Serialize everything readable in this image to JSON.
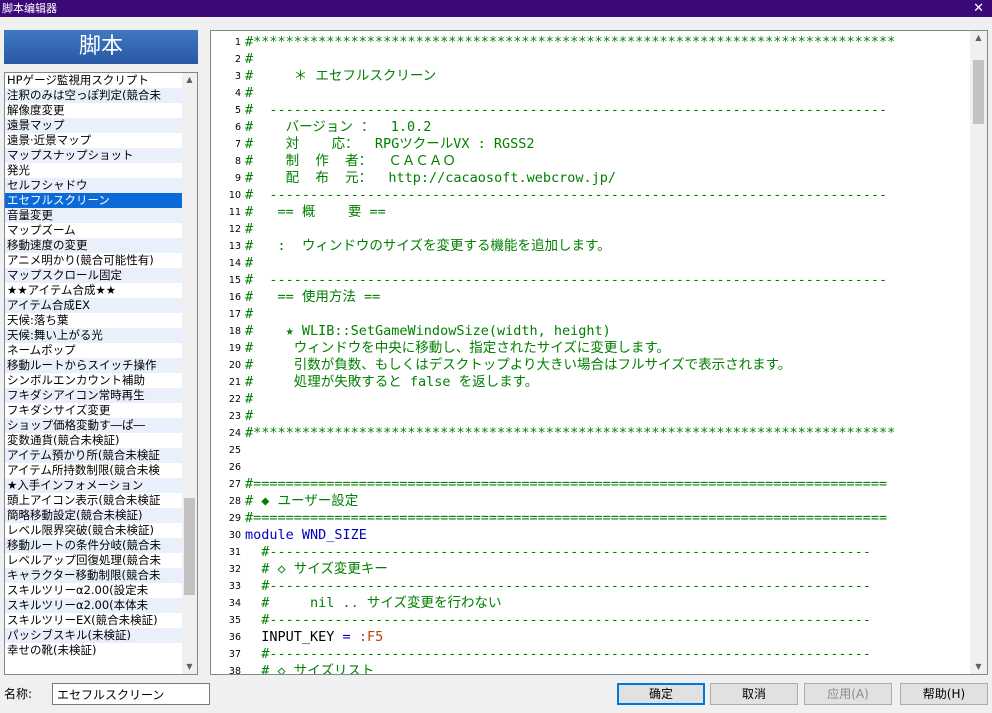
{
  "window": {
    "title": "脚本编辑器",
    "close_glyph": "✕"
  },
  "left_header": "脚本",
  "script_list": [
    "HPゲージ監視用スクリプト",
    "注釈のみは空っぽ判定(競合未",
    "解像度変更",
    "遠景マップ",
    "遠景·近景マップ",
    "マップスナップショット",
    "発光",
    "セルフシャドウ",
    "エセフルスクリーン",
    "音量変更",
    "マップズーム",
    "移動速度の変更",
    "アニメ明かり(競合可能性有)",
    "マップスクロール固定",
    "★★アイテム合成★★",
    "アイテム合成EX",
    "天候:落ち葉",
    "天候:舞い上がる光",
    "ネームポップ",
    "移動ルートからスイッチ操作",
    "シンボルエンカウント補助",
    "フキダシアイコン常時再生",
    "フキダシサイズ変更",
    "ショップ価格変動す―ぱ―",
    "変数通貨(競合未検証)",
    "アイテム預かり所(競合未検証",
    "アイテム所持数制限(競合未検",
    "★入手インフォメーション",
    "頭上アイコン表示(競合未検証",
    "簡略移動設定(競合未検証)",
    "レベル限界突破(競合未検証)",
    "移動ルートの条件分岐(競合未",
    "レベルアップ回復処理(競合未",
    "キャラクター移動制限(競合未",
    "スキルツリーα2.00(設定未",
    "スキルツリーα2.00(本体未",
    "スキルツリーEX(競合未検証)",
    "パッシブスキル(未検証)",
    "幸せの靴(未検証)"
  ],
  "selected_index": 8,
  "code_lines": [
    {
      "n": "1",
      "t": "#*******************************************************************************",
      "c": "c"
    },
    {
      "n": "2",
      "t": "#",
      "c": "c"
    },
    {
      "n": "3",
      "t": "#     ＊ エセフルスクリーン",
      "c": "c"
    },
    {
      "n": "4",
      "t": "#",
      "c": "c"
    },
    {
      "n": "5",
      "t": "#  ----------------------------------------------------------------------------",
      "c": "c"
    },
    {
      "n": "6",
      "t": "#    バージョン ：  1.0.2",
      "c": "c"
    },
    {
      "n": "7",
      "t": "#    対    応：  RPGツクールVX : RGSS2",
      "c": "c"
    },
    {
      "n": "8",
      "t": "#    制  作  者：  ＣＡＣＡＯ",
      "c": "c"
    },
    {
      "n": "9",
      "t": "#    配  布  元：  http://cacaosoft.webcrow.jp/",
      "c": "c"
    },
    {
      "n": "10",
      "t": "#  ----------------------------------------------------------------------------",
      "c": "c"
    },
    {
      "n": "11",
      "t": "#   == 概    要 ==",
      "c": "c"
    },
    {
      "n": "12",
      "t": "#",
      "c": "c"
    },
    {
      "n": "13",
      "t": "#   :  ウィンドウのサイズを変更する機能を追加します。",
      "c": "c"
    },
    {
      "n": "14",
      "t": "#",
      "c": "c"
    },
    {
      "n": "15",
      "t": "#  ----------------------------------------------------------------------------",
      "c": "c"
    },
    {
      "n": "16",
      "t": "#   == 使用方法 ==",
      "c": "c"
    },
    {
      "n": "17",
      "t": "#",
      "c": "c"
    },
    {
      "n": "18",
      "t": "#    ★ WLIB::SetGameWindowSize(width, height)",
      "c": "c"
    },
    {
      "n": "19",
      "t": "#     ウィンドウを中央に移動し、指定されたサイズに変更します。",
      "c": "c"
    },
    {
      "n": "20",
      "t": "#     引数が負数、もしくはデスクトップより大きい場合はフルサイズで表示されます。",
      "c": "c"
    },
    {
      "n": "21",
      "t": "#     処理が失敗すると false を返します。",
      "c": "c"
    },
    {
      "n": "22",
      "t": "#",
      "c": "c"
    },
    {
      "n": "23",
      "t": "#",
      "c": "c"
    },
    {
      "n": "24",
      "t": "#*******************************************************************************",
      "c": "c"
    },
    {
      "n": "25",
      "t": "",
      "c": "n"
    },
    {
      "n": "26",
      "t": "",
      "c": "n"
    },
    {
      "n": "27",
      "t": "#==============================================================================",
      "c": "c"
    },
    {
      "n": "28",
      "t": "# ◆ ユーザー設定",
      "c": "c"
    },
    {
      "n": "29",
      "t": "#==============================================================================",
      "c": "c"
    },
    {
      "n": "30",
      "t": "module WND_SIZE",
      "c": "k"
    },
    {
      "n": "31",
      "t": "  #--------------------------------------------------------------------------",
      "c": "c"
    },
    {
      "n": "32",
      "t": "  # ◇ サイズ変更キー",
      "c": "c"
    },
    {
      "n": "33",
      "t": "  #--------------------------------------------------------------------------",
      "c": "c"
    },
    {
      "n": "34",
      "t": "  #     nil .. サイズ変更を行わない",
      "c": "c"
    },
    {
      "n": "35",
      "t": "  #--------------------------------------------------------------------------",
      "c": "c"
    },
    {
      "n": "36",
      "t": "  INPUT_KEY = :F5",
      "c": "n"
    },
    {
      "n": "37",
      "t": "  #--------------------------------------------------------------------------",
      "c": "c"
    },
    {
      "n": "38",
      "t": "  # ◇ サイズリスト",
      "c": "c"
    }
  ],
  "name_field": {
    "label": "名称:",
    "value": "エセフルスクリーン"
  },
  "buttons": {
    "ok": "确定",
    "cancel": "取消",
    "apply": "应用(A)",
    "help": "帮助(H)"
  }
}
